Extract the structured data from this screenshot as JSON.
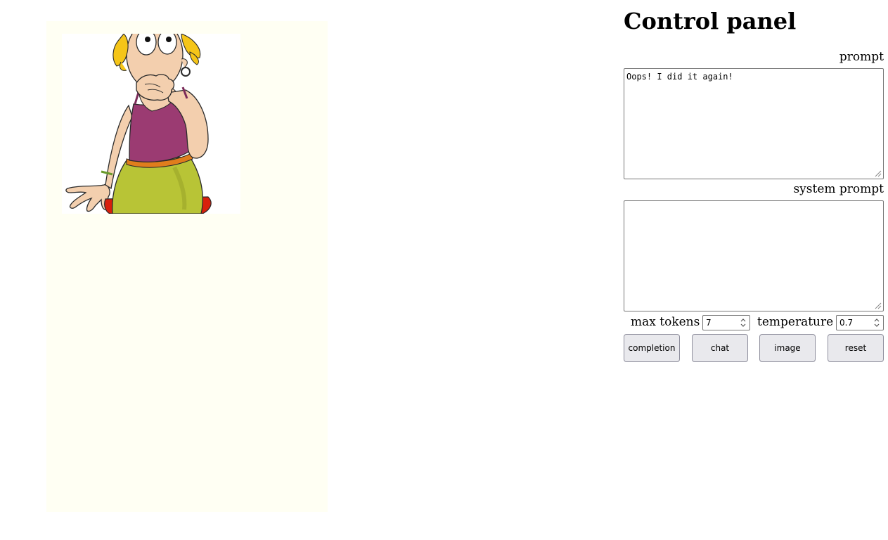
{
  "output": {
    "image_alt": "cartoon woman covering mouth"
  },
  "control_panel": {
    "title": "Control panel",
    "prompt_label": "prompt",
    "prompt_value": "Oops! I did it again!",
    "system_prompt_label": "system prompt",
    "system_prompt_value": "",
    "max_tokens_label": "max tokens",
    "max_tokens_value": "7",
    "temperature_label": "temperature",
    "temperature_value": "0.7",
    "buttons": {
      "completion": "completion",
      "chat": "chat",
      "image": "image",
      "reset": "reset"
    }
  },
  "colors": {
    "output_background": "#fffff3",
    "button_background": "#e9e9ed",
    "hair": "#f5c518",
    "top": "#9b3b72",
    "skirt": "#b8c436",
    "belt": "#e07d1c",
    "petticoat": "#d8200c",
    "skin": "#f3cfae"
  }
}
